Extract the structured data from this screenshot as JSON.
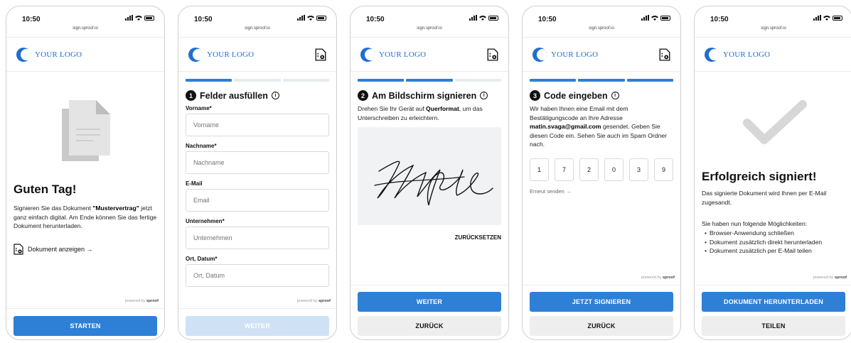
{
  "status": {
    "time": "10:50",
    "url": "sign.sproof.io"
  },
  "logo_text": "YOUR LOGO",
  "powered": {
    "prefix": "powered by",
    "brand": "sproof"
  },
  "icons": {
    "document": "document-view-icon",
    "info": "info-icon",
    "arrow": "arrow-right-icon",
    "check": "checkmark-icon"
  },
  "colors": {
    "primary": "#2e7fd6",
    "logo": "#1f6fd0"
  },
  "screen1": {
    "title": "Guten Tag!",
    "intro_before": "Signieren Sie das Dokument ",
    "intro_doc": "\"Mustervertrag\"",
    "intro_after": " jetzt ganz einfach digital. Am Ende können Sie das fertige Dokument herunterladen.",
    "view_link": "Dokument anzeigen →",
    "button": "STARTEN"
  },
  "screen2": {
    "step": "1",
    "title": "Felder ausfüllen",
    "fields": [
      {
        "label": "Vorname*",
        "placeholder": "Vorname"
      },
      {
        "label": "Nachname*",
        "placeholder": "Nachname"
      },
      {
        "label": "E-Mail",
        "placeholder": "Email"
      },
      {
        "label": "Unternehmen*",
        "placeholder": "Unternehmen"
      },
      {
        "label": "Ort, Datum*",
        "placeholder": "Ort, Datum"
      }
    ],
    "button": "WEITER",
    "progress_filled": 1
  },
  "screen3": {
    "step": "2",
    "title": "Am Bildschirm signieren",
    "text_before": "Drehen Sie Ihr Gerät auf ",
    "text_bold": "Querformat",
    "text_after": ", um das Unterschreiben zu erleichtern.",
    "reset": "ZURÜCKSETZEN",
    "button_primary": "WEITER",
    "button_secondary": "ZURÜCK",
    "progress_filled": 2
  },
  "screen4": {
    "step": "3",
    "title": "Code eingeben",
    "text_before": "Wir haben Ihnen eine Email mit dem Bestätigungscode an Ihre Adresse ",
    "email": "matin.svaga@gmail.com",
    "text_after": " gesendet. Geben Sie diesen Code ein. Sehen Sie auch im Spam Ordner nach.",
    "code": [
      "1",
      "7",
      "2",
      "0",
      "3",
      "9"
    ],
    "resend": "Erneut senden →",
    "button_primary": "JETZT SIGNIEREN",
    "button_secondary": "ZURÜCK",
    "progress_filled": 3
  },
  "screen5": {
    "title": "Erfolgreich signiert!",
    "text1": "Das signierte Dokument wird Ihnen per E-Mail zugesandt.",
    "text2": "Sie haben nun folgende Möglichkeiten:",
    "options": [
      "Browser-Anwendung schließen",
      "Dokument zusätzlich direkt herunterladen",
      "Dokument zusätzlich per E-Mail teilen"
    ],
    "button_primary": "DOKUMENT HERUNTERLADEN",
    "button_secondary": "TEILEN"
  }
}
